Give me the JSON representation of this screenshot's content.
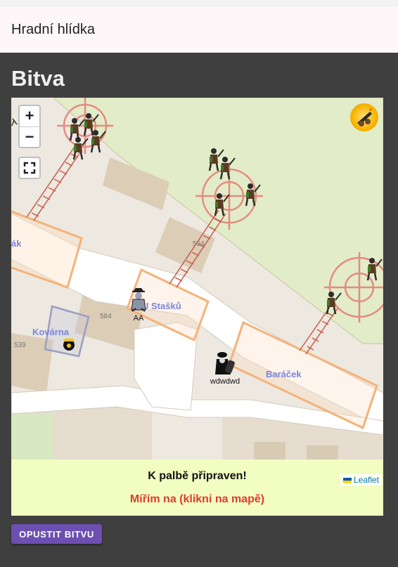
{
  "app": {
    "title": "Hradní hlídka"
  },
  "page": {
    "heading": "Bitva"
  },
  "map": {
    "zoom_in": "+",
    "zoom_out": "−",
    "places": {
      "cut_left": "ák",
      "u_stasku": "U Stašků",
      "kovarna": "Kovárna",
      "baracek": "Baráček"
    },
    "elevations": {
      "e594": "594",
      "e584": "584",
      "e539": "539"
    },
    "units": {
      "player_aa": "AA",
      "player_wdwdwd": "wdwdwd"
    },
    "attribution": "Leaflet"
  },
  "panel": {
    "status": "K palbě připraven!",
    "aim": "Mířím na (klikni na mapě)"
  },
  "actions": {
    "leave": "OPUSTIT BITVU"
  },
  "colors": {
    "page_bg": "#3f3f3f",
    "target_ring": "#e57b73",
    "building_outline": "#f5b27a",
    "leave_button": "#6c4fb0",
    "aim_text": "#e23a30",
    "panel_bg": "#f1fdc1"
  }
}
